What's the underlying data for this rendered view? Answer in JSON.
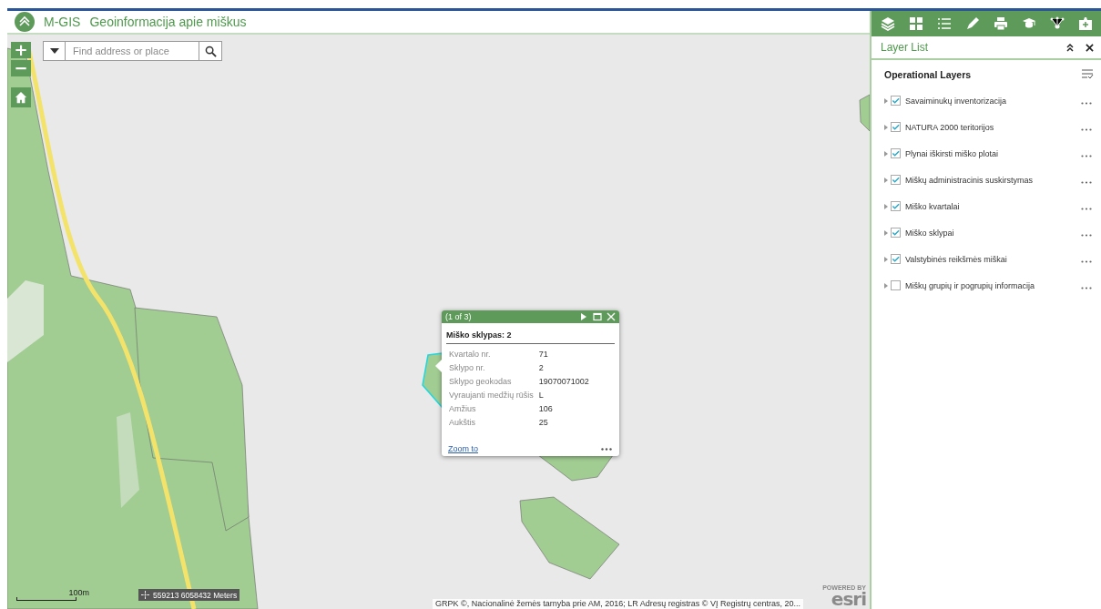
{
  "header": {
    "title": "M-GIS",
    "subtitle": "Geoinformacija apie miškus"
  },
  "map": {
    "kind": "picture",
    "zoom_in": "+",
    "zoom_out": "−",
    "search": {
      "placeholder": "Find address or place"
    },
    "coordinates": "559213 6058432 Meters",
    "scale": "100m",
    "attribution": "GRPK ©, Nacionalinė žemės tarnyba prie AM, 2016; LR Adresų registras © VĮ Registrų centras, 20...",
    "logo": {
      "caption": "POWERED BY",
      "name": "esri"
    }
  },
  "popup": {
    "counter": "(1 of 3)",
    "title": "Miško sklypas: 2",
    "fields": [
      {
        "label": "Kvartalo nr.",
        "value": "71"
      },
      {
        "label": "Sklypo nr.",
        "value": "2"
      },
      {
        "label": "Sklypo geokodas",
        "value": "19070071002"
      },
      {
        "label": "Vyraujanti medžių rūšis",
        "value": "L"
      },
      {
        "label": "Amžius",
        "value": "106"
      },
      {
        "label": "Aukštis",
        "value": "25"
      }
    ],
    "link": "Zoom to"
  },
  "panel": {
    "title": "Layer List",
    "section": "Operational Layers",
    "layers": [
      {
        "label": "Savaiminukų inventorizacija",
        "checked": true
      },
      {
        "label": "NATURA 2000 teritorijos",
        "checked": true
      },
      {
        "label": "Plynai iškirsti miško plotai",
        "checked": true
      },
      {
        "label": "Miškų administracinis suskirstymas",
        "checked": true
      },
      {
        "label": "Miško kvartalai",
        "checked": true
      },
      {
        "label": "Miško sklypai",
        "checked": true
      },
      {
        "label": "Valstybinės reikšmės miškai",
        "checked": true
      },
      {
        "label": "Miškų grupių ir pogrupių informacija",
        "checked": false
      }
    ]
  }
}
